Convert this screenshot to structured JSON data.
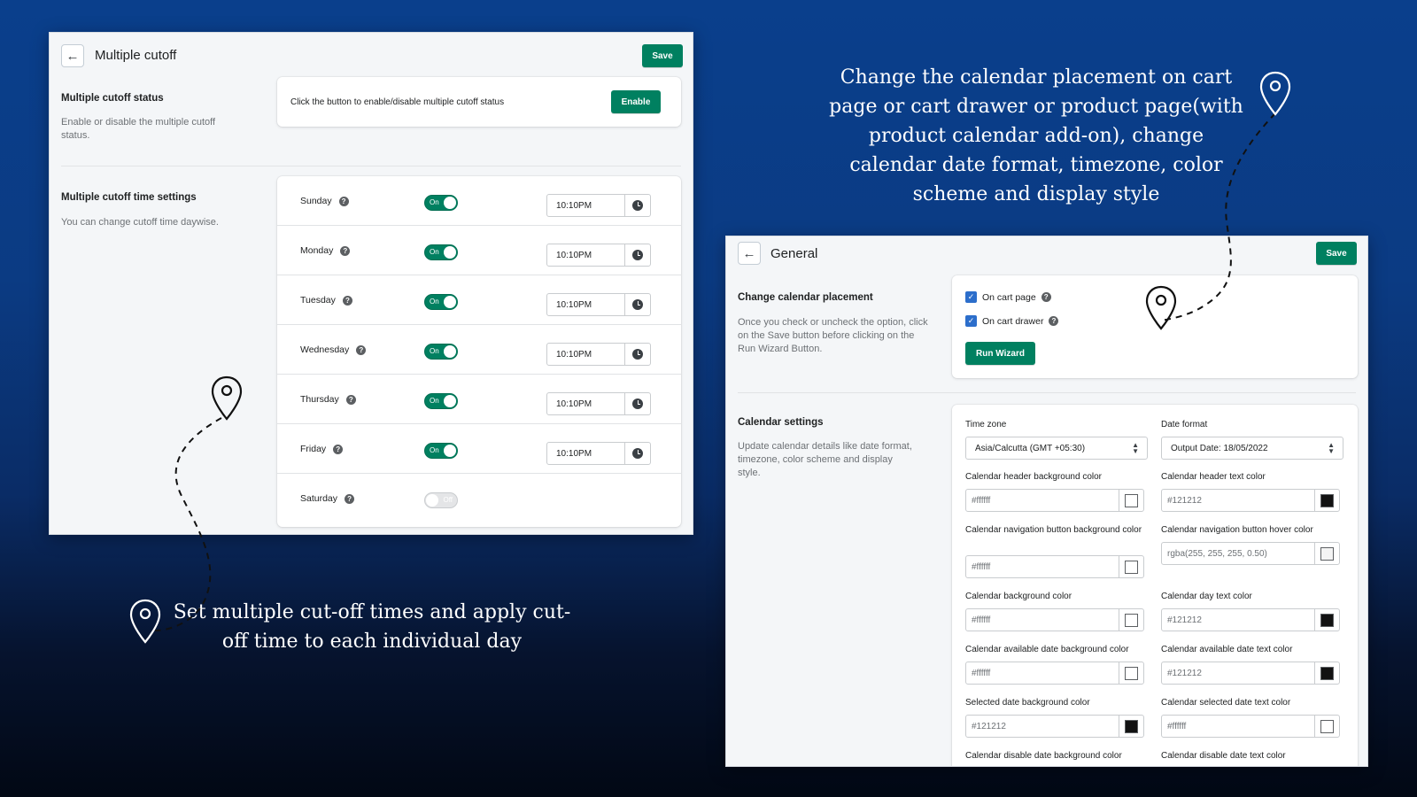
{
  "cutoff_panel": {
    "title": "Multiple cutoff",
    "save_label": "Save",
    "status_section": {
      "title": "Multiple cutoff status",
      "description": "Enable or disable the multiple cutoff status.",
      "card_text": "Click the button to enable/disable multiple cutoff status",
      "enable_label": "Enable"
    },
    "time_section": {
      "title": "Multiple cutoff time settings",
      "description": "You can change cutoff time daywise."
    },
    "days": [
      {
        "name": "Sunday",
        "toggle": "On",
        "enabled": true,
        "time": "10:10PM"
      },
      {
        "name": "Monday",
        "toggle": "On",
        "enabled": true,
        "time": "10:10PM"
      },
      {
        "name": "Tuesday",
        "toggle": "On",
        "enabled": true,
        "time": "10:10PM"
      },
      {
        "name": "Wednesday",
        "toggle": "On",
        "enabled": true,
        "time": "10:10PM"
      },
      {
        "name": "Thursday",
        "toggle": "On",
        "enabled": true,
        "time": "10:10PM"
      },
      {
        "name": "Friday",
        "toggle": "On",
        "enabled": true,
        "time": "10:10PM"
      },
      {
        "name": "Saturday",
        "toggle": "Off",
        "enabled": false,
        "time": ""
      }
    ]
  },
  "general_panel": {
    "title": "General",
    "save_label": "Save",
    "placement_section": {
      "title": "Change calendar placement",
      "description": "Once you check or uncheck the option, click on the Save button before clicking on the Run Wizard Button.",
      "options": [
        {
          "label": "On cart page",
          "checked": true
        },
        {
          "label": "On cart drawer",
          "checked": true
        }
      ],
      "run_wizard_label": "Run Wizard"
    },
    "calendar_section": {
      "title": "Calendar settings",
      "description": "Update calendar details like date format, timezone, color scheme and display style.",
      "timezone_label": "Time zone",
      "timezone_value": "Asia/Calcutta  (GMT +05:30)",
      "date_format_label": "Date format",
      "date_format_value": "Output Date: 18/05/2022",
      "colors": [
        {
          "label": "Calendar header background color",
          "value": "#ffffff",
          "swatch": "#ffffff"
        },
        {
          "label": "Calendar header text color",
          "value": "#121212",
          "swatch": "#121212"
        },
        {
          "label": "Calendar navigation button background color",
          "value": "#ffffff",
          "swatch": "#ffffff"
        },
        {
          "label": "Calendar navigation button hover color",
          "value": "rgba(255, 255, 255, 0.50)",
          "swatch": "#f4f4f4"
        },
        {
          "label": "Calendar background color",
          "value": "#ffffff",
          "swatch": "#ffffff"
        },
        {
          "label": "Calendar day text color",
          "value": "#121212",
          "swatch": "#121212"
        },
        {
          "label": "Calendar available date background color",
          "value": "#ffffff",
          "swatch": "#ffffff"
        },
        {
          "label": "Calendar available date text color",
          "value": "#121212",
          "swatch": "#121212"
        },
        {
          "label": "Selected date background color",
          "value": "#121212",
          "swatch": "#121212"
        },
        {
          "label": "Calendar selected date text color",
          "value": "#ffffff",
          "swatch": "#ffffff"
        },
        {
          "label": "Calendar disable date background color",
          "value": "",
          "swatch": ""
        },
        {
          "label": "Calendar disable date text color",
          "value": "",
          "swatch": ""
        }
      ]
    }
  },
  "captions": {
    "top_right": "Change the calendar placement on cart page or cart drawer or product page(with product calendar add-on), change calendar date format, timezone, color scheme and display style",
    "bottom_left": "Set multiple cut-off times and apply cut-off time to each individual day"
  },
  "theme": {
    "accent_green": "#008060",
    "checkbox_blue": "#2c6ecb"
  },
  "icons": {
    "back": "arrow-left-icon",
    "help": "question-circle-icon",
    "clock": "clock-icon",
    "pin": "map-pin-icon"
  }
}
